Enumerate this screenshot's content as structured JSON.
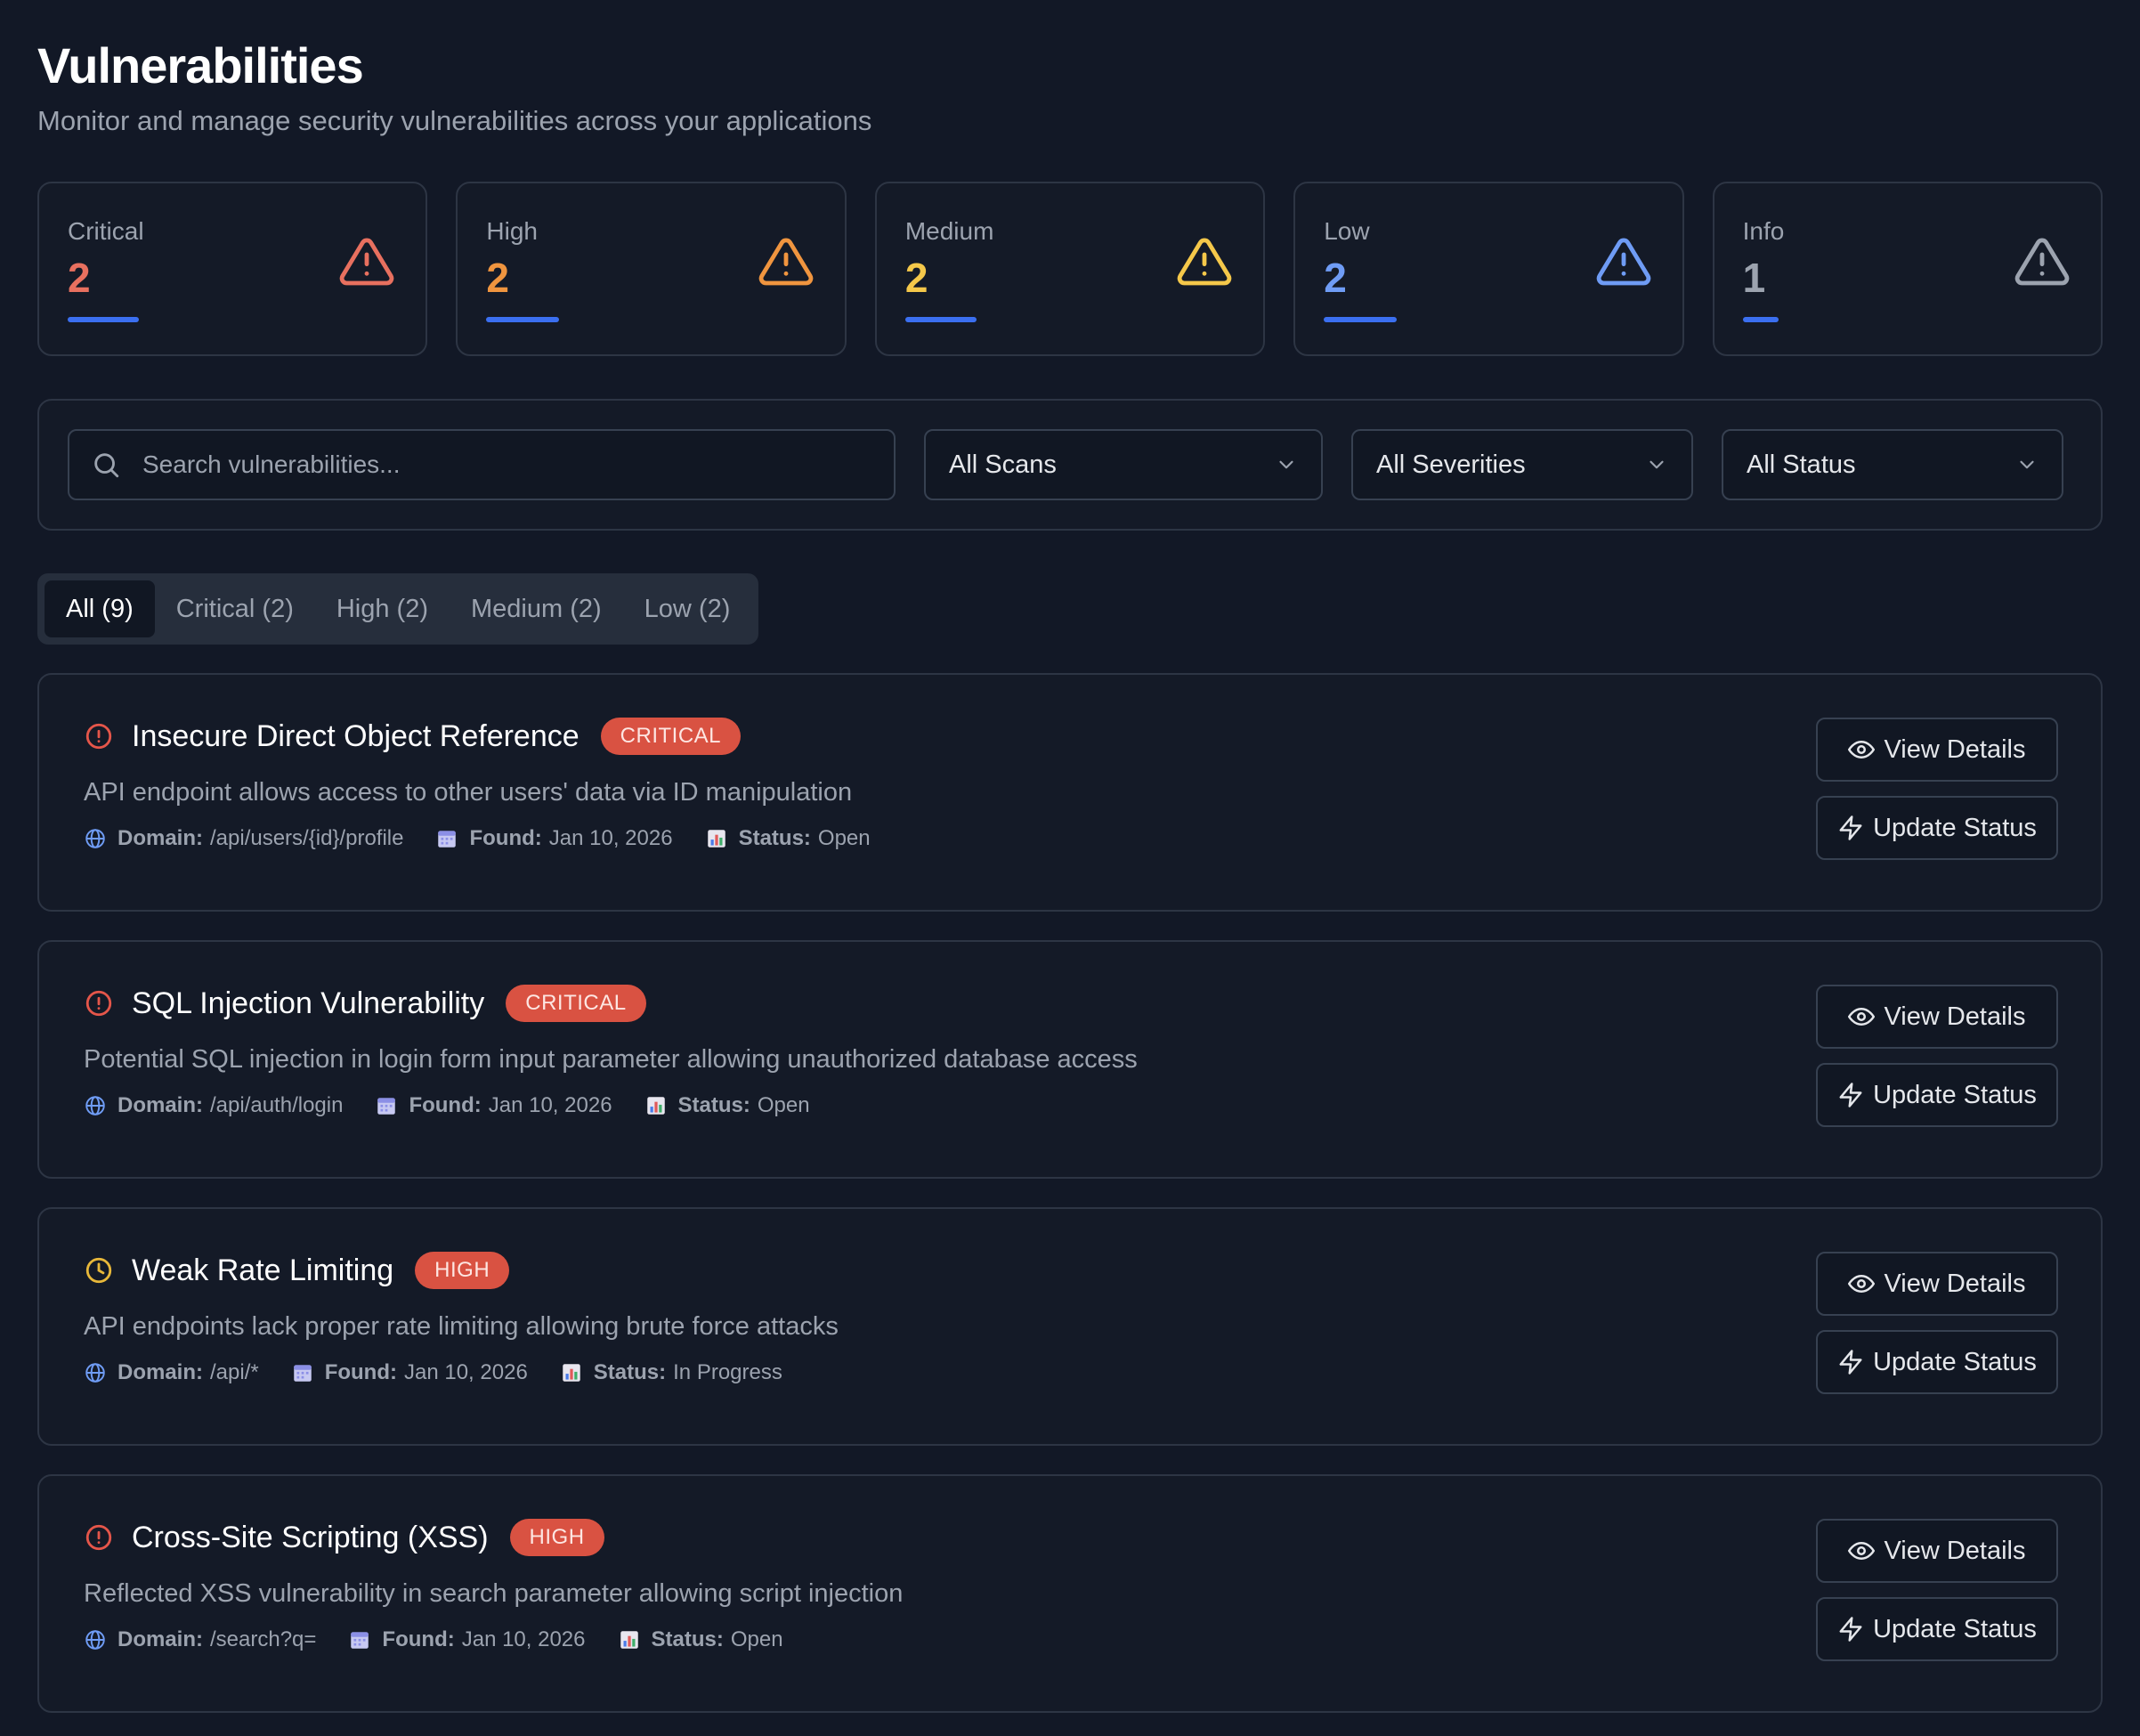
{
  "header": {
    "title": "Vulnerabilities",
    "subtitle": "Monitor and manage security vulnerabilities across your applications"
  },
  "stats": [
    {
      "label": "Critical",
      "value": "2",
      "color": "#e8705f",
      "icon": "warning-triangle-icon"
    },
    {
      "label": "High",
      "value": "2",
      "color": "#f0953f",
      "icon": "warning-triangle-icon"
    },
    {
      "label": "Medium",
      "value": "2",
      "color": "#f5c84a",
      "icon": "warning-triangle-icon"
    },
    {
      "label": "Low",
      "value": "2",
      "color": "#6f9cf5",
      "icon": "warning-triangle-icon"
    },
    {
      "label": "Info",
      "value": "1",
      "color": "#9ca3af",
      "icon": "warning-triangle-icon"
    }
  ],
  "filters": {
    "search_placeholder": "Search vulnerabilities...",
    "scan_select": "All Scans",
    "severity_select": "All Severities",
    "status_select": "All Status"
  },
  "tabs": [
    {
      "label": "All (9)",
      "active": true
    },
    {
      "label": "Critical (2)"
    },
    {
      "label": "High (2)"
    },
    {
      "label": "Medium (2)"
    },
    {
      "label": "Low (2)"
    }
  ],
  "meta_labels": {
    "domain": "Domain:",
    "found": "Found:",
    "status": "Status:"
  },
  "actions": {
    "view": "View Details",
    "update": "Update Status"
  },
  "vulnerabilities": [
    {
      "title": "Insecure Direct Object Reference",
      "badge": "CRITICAL",
      "icon": "alert-circle-icon",
      "description": "API endpoint allows access to other users' data via ID manipulation",
      "domain": "/api/users/{id}/profile",
      "found": "Jan 10, 2026",
      "status": "Open"
    },
    {
      "title": "SQL Injection Vulnerability",
      "badge": "CRITICAL",
      "icon": "alert-circle-icon",
      "description": "Potential SQL injection in login form input parameter allowing unauthorized database access",
      "domain": "/api/auth/login",
      "found": "Jan 10, 2026",
      "status": "Open"
    },
    {
      "title": "Weak Rate Limiting",
      "badge": "HIGH",
      "icon": "clock-icon",
      "description": "API endpoints lack proper rate limiting allowing brute force attacks",
      "domain": "/api/*",
      "found": "Jan 10, 2026",
      "status": "In Progress"
    },
    {
      "title": "Cross-Site Scripting (XSS)",
      "badge": "HIGH",
      "icon": "alert-circle-icon",
      "description": "Reflected XSS vulnerability in search parameter allowing script injection",
      "domain": "/search?q=",
      "found": "Jan 10, 2026",
      "status": "Open"
    }
  ]
}
